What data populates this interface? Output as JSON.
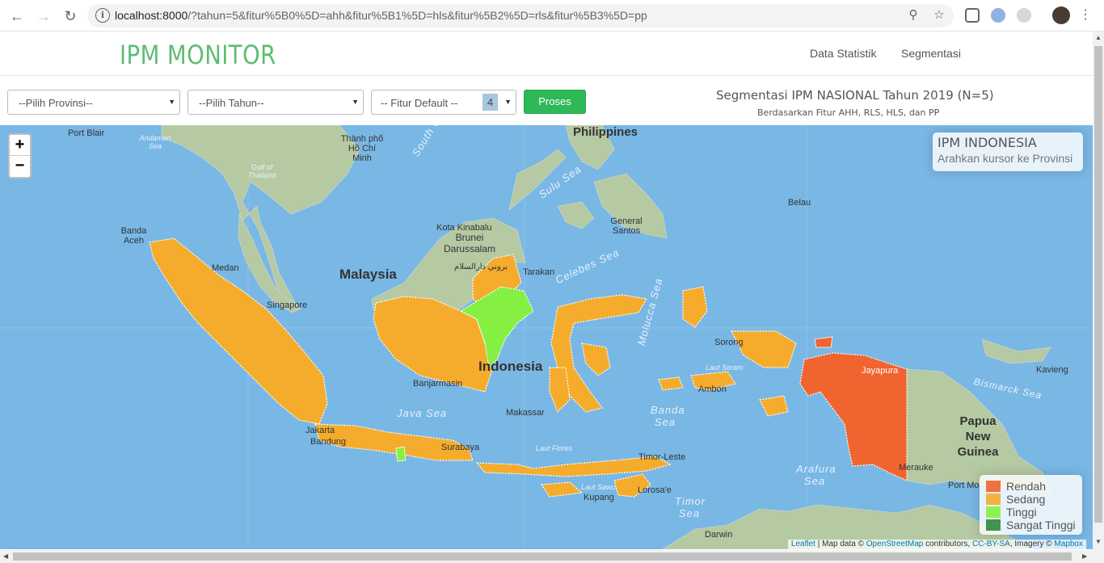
{
  "browser": {
    "url_host": "localhost:8000",
    "url_rest": "/?tahun=5&fitur%5B0%5D=ahh&fitur%5B1%5D=hls&fitur%5B2%5D=rls&fitur%5B3%5D=pp"
  },
  "navbar": {
    "brand": "IPM MONITOR",
    "links": [
      "Data Statistik",
      "Segmentasi"
    ]
  },
  "filters": {
    "province_placeholder": "--Pilih Provinsi--",
    "year_placeholder": "--Pilih Tahun--",
    "feature_placeholder": "-- Fitur Default --",
    "feature_count": "4",
    "submit_label": "Proses"
  },
  "heading": {
    "title": "Segmentasi IPM NASIONAL Tahun 2019 (N=5)",
    "subtitle": "Berdasarkan Fitur AHH, RLS, HLS, dan PP"
  },
  "map": {
    "zoom_in": "+",
    "zoom_out": "−",
    "info_title": "IPM INDONESIA",
    "info_hint": "Arahkan kursor ke Provinsi",
    "legend": [
      {
        "label": "Rendah",
        "color": "#f0642f"
      },
      {
        "label": "Sedang",
        "color": "#f5ac2c"
      },
      {
        "label": "Tinggi",
        "color": "#85f042"
      },
      {
        "label": "Sangat Tinggi",
        "color": "#2f8a3a"
      }
    ],
    "attribution": {
      "leaflet": "Leaflet",
      "text": " | Map data © ",
      "osm": "OpenStreetMap",
      "contrib": " contributors, ",
      "ccbysa": "CC-BY-SA",
      "imagery": ", Imagery © ",
      "mapbox": "Mapbox"
    },
    "places": {
      "port_blair": "Port Blair",
      "andaman_sea": "Andaman Sea",
      "thanh_pho_ho_chi_minh": "Thành phố Hồ Chí Minh",
      "gulf_of_thailand": "Gulf of Thailand",
      "south_china_sea": "South China Sea",
      "philippines": "Philippines",
      "sulu_sea": "Sulu Sea",
      "belau": "Belau",
      "general_santos": "General Santos",
      "banda_aceh": "Banda Aceh",
      "kota_kinabalu": "Kota Kinabalu",
      "brunei": "Brunei Darussalam",
      "brunei_script": "بروني دارالسلام",
      "malaysia": "Malaysia",
      "tarakan": "Tarakan",
      "celebes_sea": "Celebes Sea",
      "medan": "Medan",
      "singapore": "Singapore",
      "molucca_sea": "Molucca Sea",
      "sorong": "Sorong",
      "indonesia": "Indonesia",
      "banjarmasin": "Banjarmasin",
      "jayapura": "Jayapura",
      "kavieng": "Kavieng",
      "bismarck_sea": "Bismarck Sea",
      "laut_seram": "Laut Seram",
      "ambon": "Ambon",
      "java_sea": "Java Sea",
      "makassar": "Makassar",
      "banda_sea": "Banda Sea",
      "papua_new_guinea": "Papua New Guinea",
      "jakarta": "Jakarta",
      "bandung": "Bandung",
      "surabaya": "Surabaya",
      "laut_flores": "Laut Flores",
      "timor_leste": "Timor-Leste",
      "lorosae": "Lorosa'e",
      "arafura_sea": "Arafura Sea",
      "merauke": "Merauke",
      "port_moresby": "Port Mo",
      "laut_sawu": "Laut Sawu",
      "kupang": "Kupang",
      "timor_sea": "Timor Sea",
      "darwin": "Darwin"
    }
  }
}
